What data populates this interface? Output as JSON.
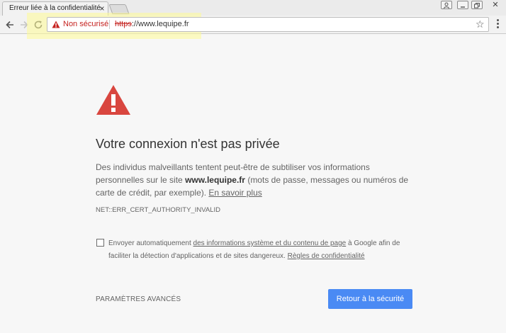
{
  "tab": {
    "title": "Erreur liée à la confidentialité",
    "close_glyph": "×"
  },
  "window": {
    "close_glyph": "✕"
  },
  "omnibox": {
    "security_label": "Non sécurisé",
    "url_scheme": "https",
    "url_rest": "://www.lequipe.fr",
    "star_glyph": "☆"
  },
  "interstitial": {
    "heading": "Votre connexion n'est pas privée",
    "desc_part1": "Des individus malveillants tentent peut-être de subtiliser vos informations personnelles sur le site ",
    "desc_site": "www.lequipe.fr",
    "desc_part2": " (mots de passe, messages ou numéros de carte de crédit, par exemple). ",
    "learn_more": "En savoir plus",
    "error_code": "NET::ERR_CERT_AUTHORITY_INVALID",
    "optin_part1": "Envoyer automatiquement ",
    "optin_link1": "des informations système et du contenu de page",
    "optin_part2": " à Google afin de faciliter la détection d'applications et de sites dangereux. ",
    "optin_link2": "Règles de confidentialité",
    "optin_checked": false,
    "advanced_label": "PARAMÈTRES AVANCÉS",
    "back_button": "Retour à la sécurité"
  },
  "colors": {
    "warning_red": "#d9463f",
    "insecure_red": "#c5221f",
    "primary_blue": "#4a8af4",
    "highlight_yellow": "#fffc96"
  }
}
